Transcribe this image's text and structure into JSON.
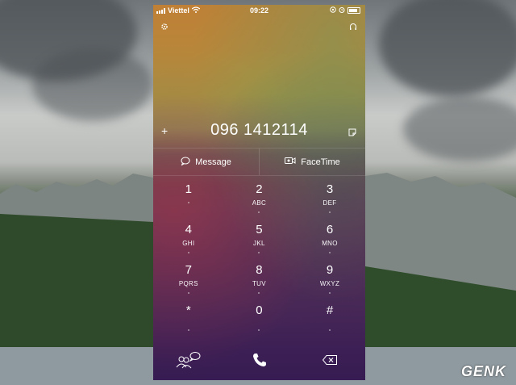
{
  "status_bar": {
    "carrier": "Viettel",
    "time": "09:22"
  },
  "dialer": {
    "number": "096 1412114",
    "message_label": "Message",
    "facetime_label": "FaceTime"
  },
  "keypad": [
    [
      {
        "digit": "1",
        "letters": ""
      },
      {
        "digit": "2",
        "letters": "ABC"
      },
      {
        "digit": "3",
        "letters": "DEF"
      }
    ],
    [
      {
        "digit": "4",
        "letters": "GHI"
      },
      {
        "digit": "5",
        "letters": "JKL"
      },
      {
        "digit": "6",
        "letters": "MNO"
      }
    ],
    [
      {
        "digit": "7",
        "letters": "PQRS"
      },
      {
        "digit": "8",
        "letters": "TUV"
      },
      {
        "digit": "9",
        "letters": "WXYZ"
      }
    ],
    [
      {
        "digit": "*",
        "letters": ""
      },
      {
        "digit": "0",
        "letters": ""
      },
      {
        "digit": "#",
        "letters": ""
      }
    ]
  ],
  "icons": {
    "settings": "gear-icon",
    "headphones": "headphones-icon",
    "add": "plus-icon",
    "paste": "note-icon",
    "contacts": "contacts-chat-icon",
    "call": "phone-icon",
    "delete": "backspace-icon"
  },
  "watermark": "GENK"
}
